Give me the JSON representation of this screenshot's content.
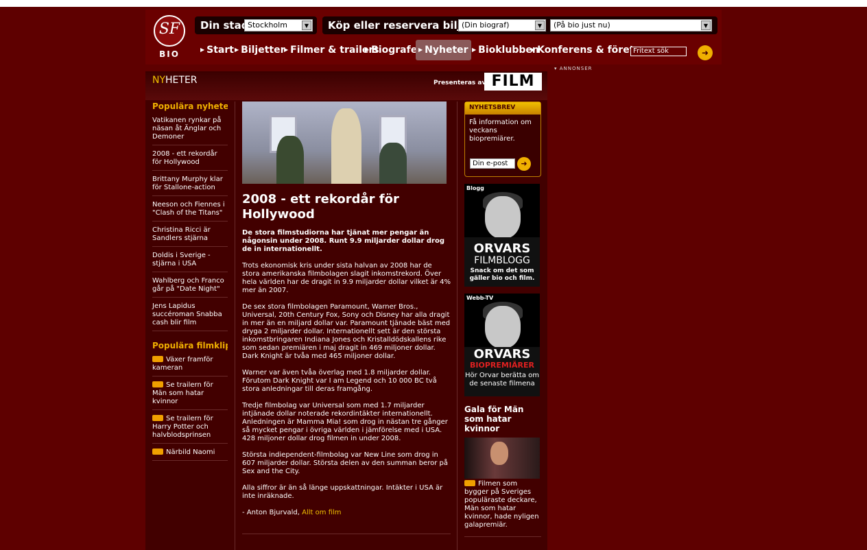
{
  "header": {
    "logo_text": "BIO",
    "logo_mark": "SF",
    "city_label": "Din stad:",
    "city_value": "Stockholm",
    "tickets_label": "Köp eller reservera biljetter:",
    "cinema_value": "(Din biograf)",
    "playing_value": "(På bio just nu)",
    "nav": [
      "Start",
      "Biljetter",
      "Filmer & trailers",
      "Biografer",
      "Nyheter",
      "Bioklubben",
      "Konferens & företag"
    ],
    "active_nav": "Nyheter",
    "search_placeholder": "Fritext sök",
    "go_glyph": "➜"
  },
  "ads_label": "▾ ANNONSER",
  "section": {
    "title_highlight": "NY",
    "title_rest": "HETER",
    "presented_by": "Presenteras av:",
    "sponsor": "FILM"
  },
  "left": {
    "news_heading": "Populära nyheter",
    "news": [
      "Vatikanen rynkar på näsan åt Änglar och Demoner",
      "2008 - ett rekordår för Hollywood",
      "Brittany Murphy klar för Stallone-action",
      "Neeson och Fiennes i \"Clash of the Titans\"",
      "Christina Ricci är Sandlers stjärna",
      "Doldis i Sverige - stjärna i USA",
      "Wahlberg och Franco går på \"Date Night\"",
      "Jens Lapidus succéroman Snabba cash blir film"
    ],
    "clips_heading": "Populära filmklipp",
    "clips": [
      "Växer framför kameran",
      "Se trailern för Män som hatar kvinnor",
      "Se trailern för Harry Potter och halvblodsprinsen",
      "Närbild Naomi"
    ]
  },
  "article": {
    "title": "2008 - ett rekordår för Hollywood",
    "lead": "De stora filmstudiorna har tjänat mer pengar än någonsin under 2008. Runt 9.9 miljarder dollar drog de in internationellt.",
    "paragraphs": [
      "Trots ekonomisk kris under sista halvan av 2008 har de stora amerikanska filmbolagen slagit inkomstrekord. Över hela världen har de dragit in 9.9 miljarder dollar vilket är 4% mer än 2007.",
      "De sex stora filmbolagen Paramount, Warner Bros., Universal, 20th Century Fox, Sony och Disney har alla dragit in mer än en miljard dollar var. Paramount tjänade bäst med dryga 2 miljarder dollar. Internationellt sett är den största inkomstbringaren Indiana Jones och Kristalldödskallens rike som sedan premiären i maj dragit in 469 miljoner dollar. Dark Knight är tvåa med 465 miljoner dollar.",
      "Warner var även tvåa överlag med 1.8 miljarder dollar. Förutom Dark Knight var I am Legend och 10 000 BC två stora anledningar till deras framgång.",
      "Tredje filmbolag var Universal som med 1.7 miljarder intjänade dollar noterade rekordintäkter internationellt. Anledningen är Mamma Mia! som drog in nästan tre gånger så mycket pengar i övriga världen i jämförelse med i USA. 428 miljoner dollar drog filmen in under 2008.",
      "Största indiependent-filmbolag var New Line som drog in 607 miljarder dollar. Största delen av den summan beror på Sex and the City.",
      "Alla siffror är än så länge uppskattningar. Intäkter i USA är inte inräknade."
    ],
    "byline": "- Anton Bjurvald,",
    "byline_link": "Allt om film"
  },
  "right": {
    "newsletter_head": "NYHETSBREV",
    "newsletter_text": "Få information om veckans biopremiärer.",
    "newsletter_placeholder": "Din e-post",
    "blog_tag": "Blogg",
    "blog_title1": "ORVARS",
    "blog_title2": "FILMBLOGG",
    "blog_sub": "Snack om det som gäller bio och film.",
    "tv_tag": "Webb-TV",
    "tv_title1": "ORVARS",
    "tv_title2": "BIOPREMIÄRER",
    "tv_sub": "Hör Orvar berätta om de senaste filmena",
    "gala_title": "Gala för Män som hatar kvinnor",
    "gala_text": "Filmen som bygger på Sveriges populäraste deckare, Män som hatar kvinnor, hade nyligen galapremiär."
  }
}
